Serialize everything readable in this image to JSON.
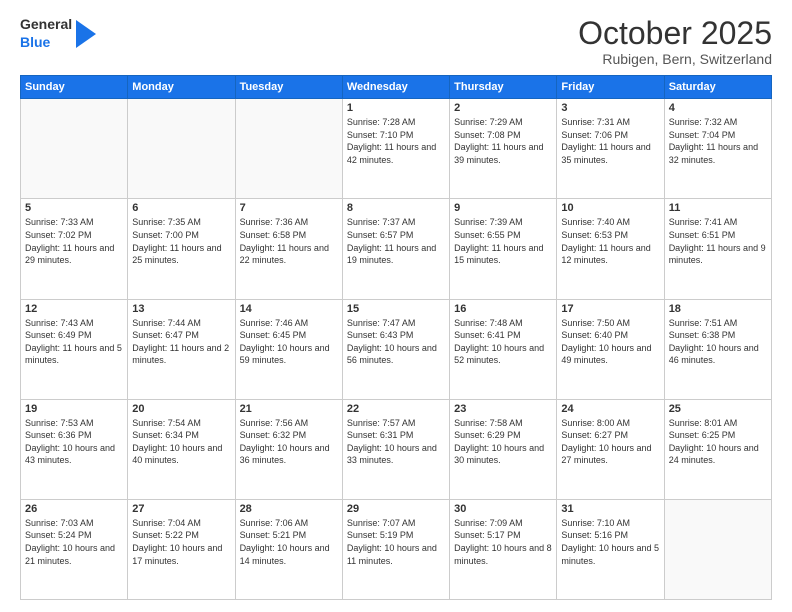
{
  "header": {
    "logo_general": "General",
    "logo_blue": "Blue",
    "month_title": "October 2025",
    "location": "Rubigen, Bern, Switzerland"
  },
  "weekdays": [
    "Sunday",
    "Monday",
    "Tuesday",
    "Wednesday",
    "Thursday",
    "Friday",
    "Saturday"
  ],
  "weeks": [
    [
      {
        "day": "",
        "sunrise": "",
        "sunset": "",
        "daylight": ""
      },
      {
        "day": "",
        "sunrise": "",
        "sunset": "",
        "daylight": ""
      },
      {
        "day": "",
        "sunrise": "",
        "sunset": "",
        "daylight": ""
      },
      {
        "day": "1",
        "sunrise": "Sunrise: 7:28 AM",
        "sunset": "Sunset: 7:10 PM",
        "daylight": "Daylight: 11 hours and 42 minutes."
      },
      {
        "day": "2",
        "sunrise": "Sunrise: 7:29 AM",
        "sunset": "Sunset: 7:08 PM",
        "daylight": "Daylight: 11 hours and 39 minutes."
      },
      {
        "day": "3",
        "sunrise": "Sunrise: 7:31 AM",
        "sunset": "Sunset: 7:06 PM",
        "daylight": "Daylight: 11 hours and 35 minutes."
      },
      {
        "day": "4",
        "sunrise": "Sunrise: 7:32 AM",
        "sunset": "Sunset: 7:04 PM",
        "daylight": "Daylight: 11 hours and 32 minutes."
      }
    ],
    [
      {
        "day": "5",
        "sunrise": "Sunrise: 7:33 AM",
        "sunset": "Sunset: 7:02 PM",
        "daylight": "Daylight: 11 hours and 29 minutes."
      },
      {
        "day": "6",
        "sunrise": "Sunrise: 7:35 AM",
        "sunset": "Sunset: 7:00 PM",
        "daylight": "Daylight: 11 hours and 25 minutes."
      },
      {
        "day": "7",
        "sunrise": "Sunrise: 7:36 AM",
        "sunset": "Sunset: 6:58 PM",
        "daylight": "Daylight: 11 hours and 22 minutes."
      },
      {
        "day": "8",
        "sunrise": "Sunrise: 7:37 AM",
        "sunset": "Sunset: 6:57 PM",
        "daylight": "Daylight: 11 hours and 19 minutes."
      },
      {
        "day": "9",
        "sunrise": "Sunrise: 7:39 AM",
        "sunset": "Sunset: 6:55 PM",
        "daylight": "Daylight: 11 hours and 15 minutes."
      },
      {
        "day": "10",
        "sunrise": "Sunrise: 7:40 AM",
        "sunset": "Sunset: 6:53 PM",
        "daylight": "Daylight: 11 hours and 12 minutes."
      },
      {
        "day": "11",
        "sunrise": "Sunrise: 7:41 AM",
        "sunset": "Sunset: 6:51 PM",
        "daylight": "Daylight: 11 hours and 9 minutes."
      }
    ],
    [
      {
        "day": "12",
        "sunrise": "Sunrise: 7:43 AM",
        "sunset": "Sunset: 6:49 PM",
        "daylight": "Daylight: 11 hours and 5 minutes."
      },
      {
        "day": "13",
        "sunrise": "Sunrise: 7:44 AM",
        "sunset": "Sunset: 6:47 PM",
        "daylight": "Daylight: 11 hours and 2 minutes."
      },
      {
        "day": "14",
        "sunrise": "Sunrise: 7:46 AM",
        "sunset": "Sunset: 6:45 PM",
        "daylight": "Daylight: 10 hours and 59 minutes."
      },
      {
        "day": "15",
        "sunrise": "Sunrise: 7:47 AM",
        "sunset": "Sunset: 6:43 PM",
        "daylight": "Daylight: 10 hours and 56 minutes."
      },
      {
        "day": "16",
        "sunrise": "Sunrise: 7:48 AM",
        "sunset": "Sunset: 6:41 PM",
        "daylight": "Daylight: 10 hours and 52 minutes."
      },
      {
        "day": "17",
        "sunrise": "Sunrise: 7:50 AM",
        "sunset": "Sunset: 6:40 PM",
        "daylight": "Daylight: 10 hours and 49 minutes."
      },
      {
        "day": "18",
        "sunrise": "Sunrise: 7:51 AM",
        "sunset": "Sunset: 6:38 PM",
        "daylight": "Daylight: 10 hours and 46 minutes."
      }
    ],
    [
      {
        "day": "19",
        "sunrise": "Sunrise: 7:53 AM",
        "sunset": "Sunset: 6:36 PM",
        "daylight": "Daylight: 10 hours and 43 minutes."
      },
      {
        "day": "20",
        "sunrise": "Sunrise: 7:54 AM",
        "sunset": "Sunset: 6:34 PM",
        "daylight": "Daylight: 10 hours and 40 minutes."
      },
      {
        "day": "21",
        "sunrise": "Sunrise: 7:56 AM",
        "sunset": "Sunset: 6:32 PM",
        "daylight": "Daylight: 10 hours and 36 minutes."
      },
      {
        "day": "22",
        "sunrise": "Sunrise: 7:57 AM",
        "sunset": "Sunset: 6:31 PM",
        "daylight": "Daylight: 10 hours and 33 minutes."
      },
      {
        "day": "23",
        "sunrise": "Sunrise: 7:58 AM",
        "sunset": "Sunset: 6:29 PM",
        "daylight": "Daylight: 10 hours and 30 minutes."
      },
      {
        "day": "24",
        "sunrise": "Sunrise: 8:00 AM",
        "sunset": "Sunset: 6:27 PM",
        "daylight": "Daylight: 10 hours and 27 minutes."
      },
      {
        "day": "25",
        "sunrise": "Sunrise: 8:01 AM",
        "sunset": "Sunset: 6:25 PM",
        "daylight": "Daylight: 10 hours and 24 minutes."
      }
    ],
    [
      {
        "day": "26",
        "sunrise": "Sunrise: 7:03 AM",
        "sunset": "Sunset: 5:24 PM",
        "daylight": "Daylight: 10 hours and 21 minutes."
      },
      {
        "day": "27",
        "sunrise": "Sunrise: 7:04 AM",
        "sunset": "Sunset: 5:22 PM",
        "daylight": "Daylight: 10 hours and 17 minutes."
      },
      {
        "day": "28",
        "sunrise": "Sunrise: 7:06 AM",
        "sunset": "Sunset: 5:21 PM",
        "daylight": "Daylight: 10 hours and 14 minutes."
      },
      {
        "day": "29",
        "sunrise": "Sunrise: 7:07 AM",
        "sunset": "Sunset: 5:19 PM",
        "daylight": "Daylight: 10 hours and 11 minutes."
      },
      {
        "day": "30",
        "sunrise": "Sunrise: 7:09 AM",
        "sunset": "Sunset: 5:17 PM",
        "daylight": "Daylight: 10 hours and 8 minutes."
      },
      {
        "day": "31",
        "sunrise": "Sunrise: 7:10 AM",
        "sunset": "Sunset: 5:16 PM",
        "daylight": "Daylight: 10 hours and 5 minutes."
      },
      {
        "day": "",
        "sunrise": "",
        "sunset": "",
        "daylight": ""
      }
    ]
  ]
}
